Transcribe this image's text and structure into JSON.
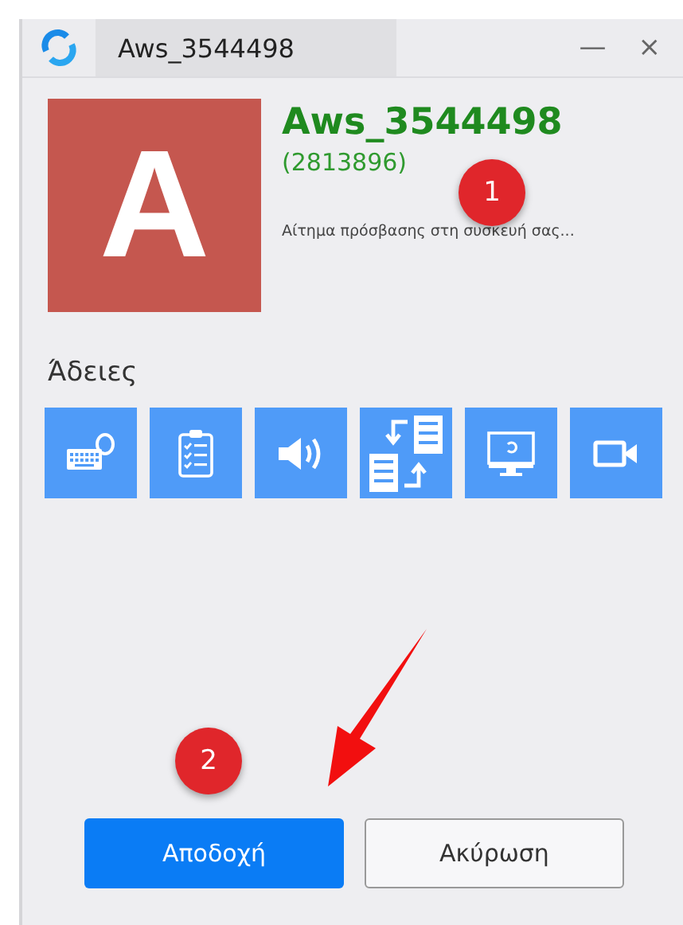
{
  "window": {
    "title": "Aws_3544498",
    "controls": [
      "—",
      "×"
    ]
  },
  "requester": {
    "avatar_letter": "A",
    "name": "Aws_3544498",
    "id": "(2813896)",
    "message": "Αίτημα πρόσβασης στη συσκευή σας..."
  },
  "permissions": {
    "title": "Άδειες",
    "items": [
      {
        "kind": "keyboard"
      },
      {
        "kind": "clipboard"
      },
      {
        "kind": "sound"
      },
      {
        "kind": "files"
      },
      {
        "kind": "screen"
      },
      {
        "kind": "camera"
      }
    ]
  },
  "buttons": [
    {
      "label": "Αποδοχή",
      "kind": "primary"
    },
    {
      "label": "Ακύρωση",
      "kind": "secondary"
    }
  ],
  "annotations": [
    {
      "label": "1"
    },
    {
      "label": "2"
    }
  ]
}
